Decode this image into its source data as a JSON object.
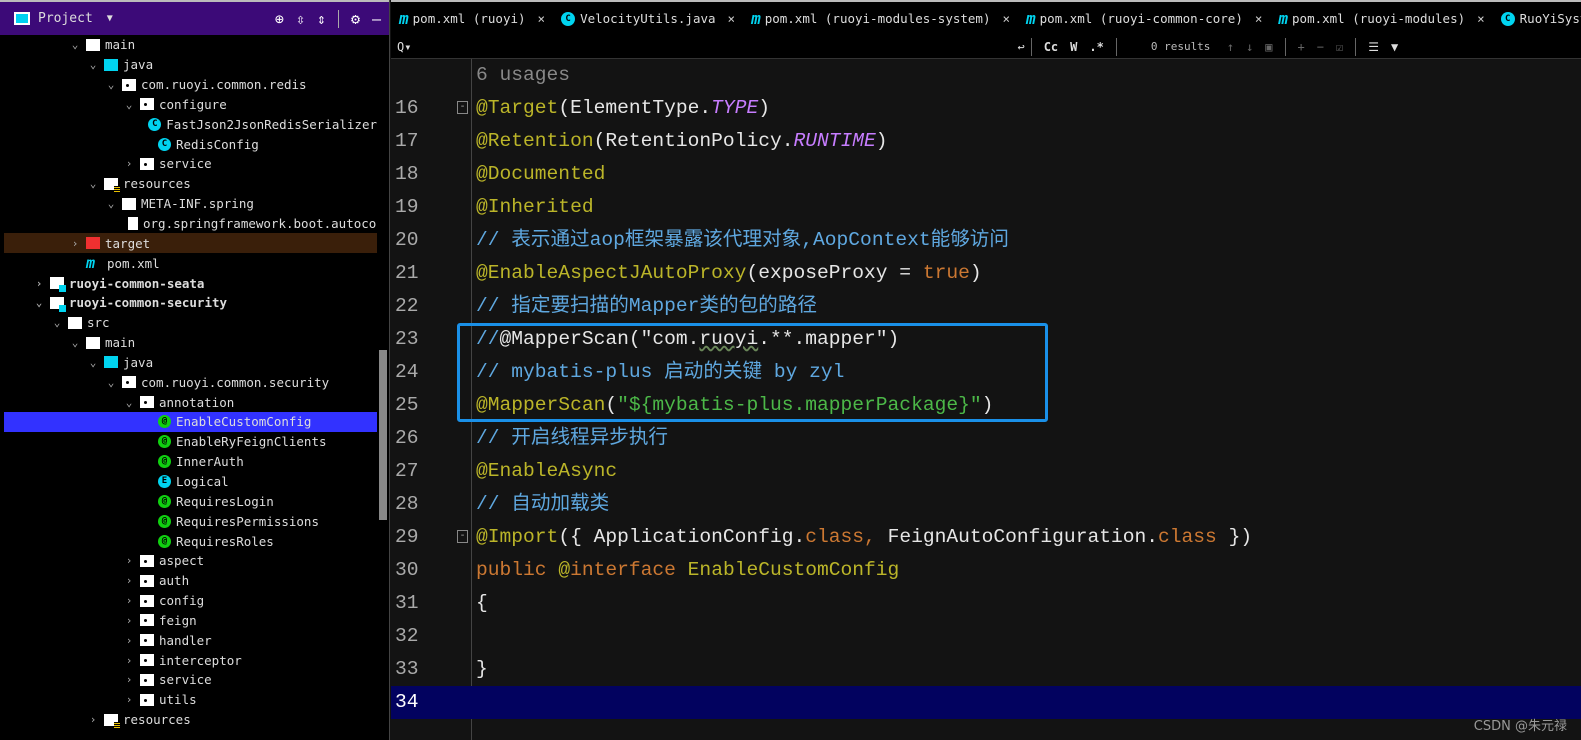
{
  "project_panel": {
    "title": "Project",
    "tools": [
      "locate-icon",
      "expand-all-icon",
      "collapse-all-icon",
      "gear-icon",
      "minimize-icon"
    ],
    "tree": [
      {
        "label": "main",
        "level": 2,
        "icon": "folder",
        "open": true
      },
      {
        "label": "java",
        "level": 3,
        "icon": "src",
        "open": true
      },
      {
        "label": "com.ruoyi.common.redis",
        "level": 4,
        "icon": "pkg",
        "open": true
      },
      {
        "label": "configure",
        "level": 5,
        "icon": "pkg",
        "open": true
      },
      {
        "label": "FastJson2JsonRedisSerializer",
        "level": 6,
        "icon": "cls"
      },
      {
        "label": "RedisConfig",
        "level": 6,
        "icon": "cls"
      },
      {
        "label": "service",
        "level": 5,
        "icon": "pkg",
        "open": false
      },
      {
        "label": "resources",
        "level": 3,
        "icon": "res",
        "open": true
      },
      {
        "label": "META-INF.spring",
        "level": 4,
        "icon": "folder",
        "open": true
      },
      {
        "label": "org.springframework.boot.autoconf",
        "level": 5,
        "icon": "file"
      },
      {
        "label": "target",
        "level": 2,
        "icon": "red",
        "open": false,
        "excluded": true
      },
      {
        "label": "pom.xml",
        "level": 2,
        "icon": "mvn"
      },
      {
        "label": "ruoyi-common-seata",
        "level": 0,
        "icon": "mod",
        "open": false,
        "bold": true
      },
      {
        "label": "ruoyi-common-security",
        "level": 0,
        "icon": "mod",
        "open": true,
        "bold": true
      },
      {
        "label": "src",
        "level": 1,
        "icon": "folder",
        "open": true
      },
      {
        "label": "main",
        "level": 2,
        "icon": "folder",
        "open": true
      },
      {
        "label": "java",
        "level": 3,
        "icon": "src",
        "open": true
      },
      {
        "label": "com.ruoyi.common.security",
        "level": 4,
        "icon": "pkg",
        "open": true
      },
      {
        "label": "annotation",
        "level": 5,
        "icon": "pkg",
        "open": true
      },
      {
        "label": "EnableCustomConfig",
        "level": 6,
        "icon": "ann",
        "selected": true
      },
      {
        "label": "EnableRyFeignClients",
        "level": 6,
        "icon": "ann"
      },
      {
        "label": "InnerAuth",
        "level": 6,
        "icon": "ann"
      },
      {
        "label": "Logical",
        "level": 6,
        "icon": "enum"
      },
      {
        "label": "RequiresLogin",
        "level": 6,
        "icon": "ann"
      },
      {
        "label": "RequiresPermissions",
        "level": 6,
        "icon": "ann"
      },
      {
        "label": "RequiresRoles",
        "level": 6,
        "icon": "ann"
      },
      {
        "label": "aspect",
        "level": 5,
        "icon": "pkg",
        "open": false
      },
      {
        "label": "auth",
        "level": 5,
        "icon": "pkg",
        "open": false
      },
      {
        "label": "config",
        "level": 5,
        "icon": "pkg",
        "open": false
      },
      {
        "label": "feign",
        "level": 5,
        "icon": "pkg",
        "open": false
      },
      {
        "label": "handler",
        "level": 5,
        "icon": "pkg",
        "open": false
      },
      {
        "label": "interceptor",
        "level": 5,
        "icon": "pkg",
        "open": false
      },
      {
        "label": "service",
        "level": 5,
        "icon": "pkg",
        "open": false
      },
      {
        "label": "utils",
        "level": 5,
        "icon": "pkg",
        "open": false
      },
      {
        "label": "resources",
        "level": 3,
        "icon": "res",
        "open": false
      }
    ]
  },
  "tabs": [
    {
      "label": "pom.xml (ruoyi)",
      "icon": "maven-icon"
    },
    {
      "label": "VelocityUtils.java",
      "icon": "class-icon"
    },
    {
      "label": "pom.xml (ruoyi-modules-system)",
      "icon": "maven-icon"
    },
    {
      "label": "pom.xml (ruoyi-common-core)",
      "icon": "maven-icon"
    },
    {
      "label": "pom.xml (ruoyi-modules)",
      "icon": "maven-icon"
    },
    {
      "label": "RuoYiSystemApp",
      "icon": "spring-app-icon"
    }
  ],
  "find": {
    "query": "",
    "match_case": "Cc",
    "words": "W",
    "regex": ".*",
    "results": "0 results"
  },
  "editor": {
    "usages": "6 usages",
    "lines": [
      {
        "n": "16",
        "fold": true,
        "seg": [
          [
            "ann",
            "@Target"
          ],
          [
            "plain",
            "(ElementType."
          ],
          [
            "const",
            "TYPE"
          ],
          [
            "plain",
            ")"
          ]
        ]
      },
      {
        "n": "17",
        "seg": [
          [
            "ann",
            "@Retention"
          ],
          [
            "plain",
            "(RetentionPolicy."
          ],
          [
            "const",
            "RUNTIME"
          ],
          [
            "plain",
            ")"
          ]
        ]
      },
      {
        "n": "18",
        "seg": [
          [
            "ann",
            "@Documented"
          ]
        ]
      },
      {
        "n": "19",
        "seg": [
          [
            "ann",
            "@Inherited"
          ]
        ]
      },
      {
        "n": "20",
        "seg": [
          [
            "cmt",
            "// 表示通过aop框架暴露该代理对象,AopContext能够访问"
          ]
        ]
      },
      {
        "n": "21",
        "seg": [
          [
            "ann",
            "@EnableAspectJAutoProxy"
          ],
          [
            "plain",
            "(exposeProxy = "
          ],
          [
            "kw",
            "true"
          ],
          [
            "plain",
            ")"
          ]
        ]
      },
      {
        "n": "22",
        "seg": [
          [
            "cmt",
            "// 指定要扫描的Mapper类的包的路径"
          ]
        ]
      },
      {
        "n": "23",
        "seg": [
          [
            "cmt",
            "//"
          ],
          [
            "plain",
            "@MapperScan(\"com."
          ],
          [
            "squig",
            "ruoyi"
          ],
          [
            "plain",
            ".**.mapper\")"
          ]
        ]
      },
      {
        "n": "24",
        "seg": [
          [
            "cmt",
            "// mybatis-plus 启动的关键 by zyl"
          ]
        ]
      },
      {
        "n": "25",
        "seg": [
          [
            "ann",
            "@MapperScan"
          ],
          [
            "plain",
            "("
          ],
          [
            "str",
            "\"${mybatis-plus.mapperPackage}\""
          ],
          [
            "plain",
            ")"
          ]
        ]
      },
      {
        "n": "26",
        "seg": [
          [
            "cmt",
            "// 开启线程异步执行"
          ]
        ]
      },
      {
        "n": "27",
        "seg": [
          [
            "ann",
            "@EnableAsync"
          ]
        ]
      },
      {
        "n": "28",
        "seg": [
          [
            "cmt",
            "// 自动加载类"
          ]
        ]
      },
      {
        "n": "29",
        "fold": true,
        "seg": [
          [
            "ann",
            "@Import"
          ],
          [
            "plain",
            "({ ApplicationConfig."
          ],
          [
            "kw",
            "class"
          ],
          [
            "kw",
            ", "
          ],
          [
            "plain",
            "FeignAutoConfiguration."
          ],
          [
            "kw",
            "class"
          ],
          [
            "plain",
            " })"
          ]
        ]
      },
      {
        "n": "30",
        "seg": [
          [
            "kw",
            "public "
          ],
          [
            "ann",
            "@"
          ],
          [
            "kw",
            "interface "
          ],
          [
            "cls",
            "EnableCustomConfig"
          ]
        ]
      },
      {
        "n": "31",
        "seg": [
          [
            "plain",
            "{"
          ]
        ]
      },
      {
        "n": "32",
        "seg": []
      },
      {
        "n": "33",
        "seg": [
          [
            "plain",
            "}"
          ]
        ]
      },
      {
        "n": "34",
        "current": true,
        "seg": []
      }
    ]
  },
  "watermark": "CSDN @朱元禄",
  "colors": {
    "project_header": "#3c0a78",
    "selection": "#3232ff",
    "current_line": "#02025f",
    "highlight_box": "#1a90e8",
    "annotation": "#bbb529",
    "comment": "#5fa8e0",
    "keyword": "#cc7832",
    "string": "#4cb848"
  }
}
